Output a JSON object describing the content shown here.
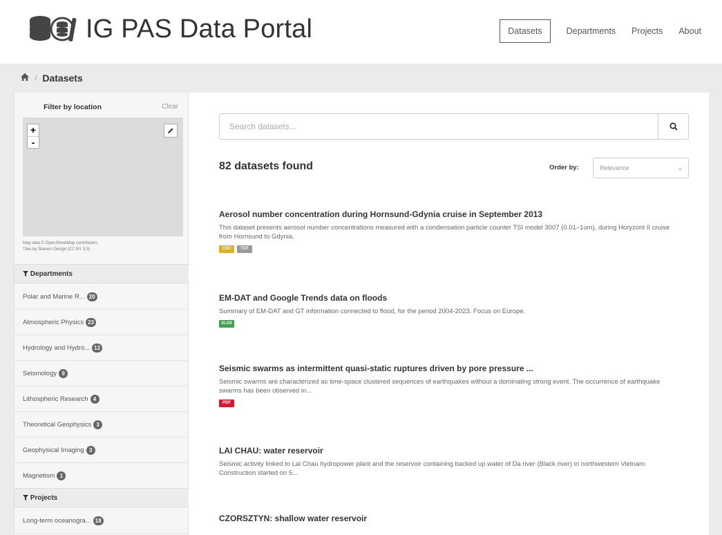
{
  "header": {
    "brand": "IG PAS Data Portal",
    "nav": [
      {
        "label": "Datasets",
        "active": true
      },
      {
        "label": "Departments",
        "active": false
      },
      {
        "label": "Projects",
        "active": false
      },
      {
        "label": "About",
        "active": false
      }
    ]
  },
  "breadcrumb": {
    "current": "Datasets"
  },
  "sidebar": {
    "location": {
      "title": "Filter by location",
      "clear": "Clear",
      "zoom_in": "+",
      "zoom_out": "-",
      "attribution_line1": "Map data © OpenStreetMap contributors",
      "attribution_line2": "Tiles by Stamen Design (CC BY 3.0)"
    },
    "departments": {
      "title": "Departments",
      "items": [
        {
          "label": "Polar and Marine R...",
          "count": "20"
        },
        {
          "label": "Atmospheric Physics",
          "count": "23"
        },
        {
          "label": "Hydrology and Hydro...",
          "count": "12"
        },
        {
          "label": "Seismology",
          "count": "9"
        },
        {
          "label": "Lithospheric Research",
          "count": "4"
        },
        {
          "label": "Theoretical Geophysics",
          "count": "3"
        },
        {
          "label": "Geophysical Imaging",
          "count": "3"
        },
        {
          "label": "Magnetism",
          "count": "1"
        }
      ]
    },
    "projects": {
      "title": "Projects",
      "items": [
        {
          "label": "Long-term oceanogra...",
          "count": "18"
        }
      ]
    }
  },
  "search": {
    "placeholder": "Search datasets..."
  },
  "results": {
    "count_text": "82 datasets found",
    "order_label": "Order by:",
    "order_value": "Relevance",
    "datasets": [
      {
        "title": "Aerosol number concentration during Hornsund-Gdynia cruise in September 2013",
        "description": "This dataset presents aerosol number concentrations measured with a condensation particle counter TSI model 3007 (0.01–1um), during Horyzont II cruise from Hornsund to Gdynia.",
        "formats": [
          {
            "label": "CSV",
            "color": "#dfb318"
          },
          {
            "label": "TXT",
            "color": "#9a9a9a"
          }
        ]
      },
      {
        "title": "EM-DAT and Google Trends data on floods",
        "description": "Summary of EM-DAT and GT information connected to flood, for the period 2004-2023. Focus on Europe.",
        "formats": [
          {
            "label": "XLSX",
            "color": "#3aa44d"
          }
        ]
      },
      {
        "title": "Seismic swarms as intermittent quasi-static ruptures driven by pore pressure ...",
        "description": "Seismic swarms are characterized as time-space clustered sequences of earthquakes without a dominating strong event. The occurrence of earthquake swarms has been observed in...",
        "formats": [
          {
            "label": "PDF",
            "color": "#d01c2c"
          }
        ]
      },
      {
        "title": "LAI CHAU: water reservoir",
        "description": "Seismic activity linked to Lai Chau hydropower plant and the reservoir containing backed up water of Da river (Black river) in northwestern Vietnam. Construction started on 5...",
        "formats": []
      },
      {
        "title": "CZORSZTYN: shallow water reservoir",
        "description": "",
        "formats": []
      }
    ]
  }
}
